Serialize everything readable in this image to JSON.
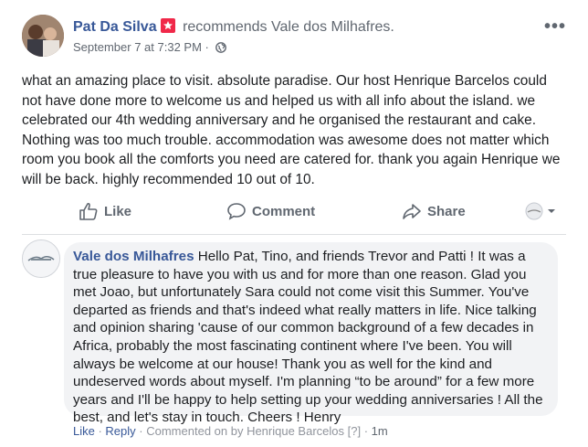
{
  "post": {
    "author": "Pat Da Silva",
    "recommends_label": "recommends",
    "page_name": "Vale dos Milhafres.",
    "date": "September 7 at 7:32 PM",
    "separator": "·",
    "privacy_icon": "globe-icon",
    "more_icon": "•••",
    "text": "what an amazing place to visit. absolute paradise. Our host Henrique Barcelos could not have done more to welcome us and helped us with all info about the island. we celebrated our 4th wedding anniversary and he organised the restaurant and cake. Nothing was too much trouble. accommodation was awesome does not matter which room you book all the comforts you need are catered for. thank you again Henrique we will be back. highly recommended 10 out of 10."
  },
  "actions": {
    "like_label": "Like",
    "comment_label": "Comment",
    "share_label": "Share"
  },
  "reply": {
    "author": "Vale dos Milhafres",
    "text": "Hello Pat, Tino, and friends Trevor and Patti ! It was a true pleasure to have you with us and for more than one reason. Glad you met Joao, but unfortunately Sara could not come visit this Summer. You've departed as friends and that's indeed what really matters in life. Nice talking and opinion sharing 'cause of our common background of a few decades in Africa, probably the most fascinating continent where I've been. You will always be welcome at our house! Thank you as well for the kind and undeserved words about myself. I'm planning “to be around” for a few more years and I'll be happy to help setting up your wedding anniversaries ! All the best, and let's stay in touch. Cheers ! Henry",
    "like_label": "Like",
    "reply_label": "Reply",
    "sep": " · ",
    "commented_on_by": "Commented on by Henrique Barcelos",
    "help_mark": "[?]",
    "time": "1m"
  },
  "colors": {
    "link": "#385898",
    "meta": "#606770",
    "bubble": "#f2f3f5",
    "badge": "#f02849"
  }
}
